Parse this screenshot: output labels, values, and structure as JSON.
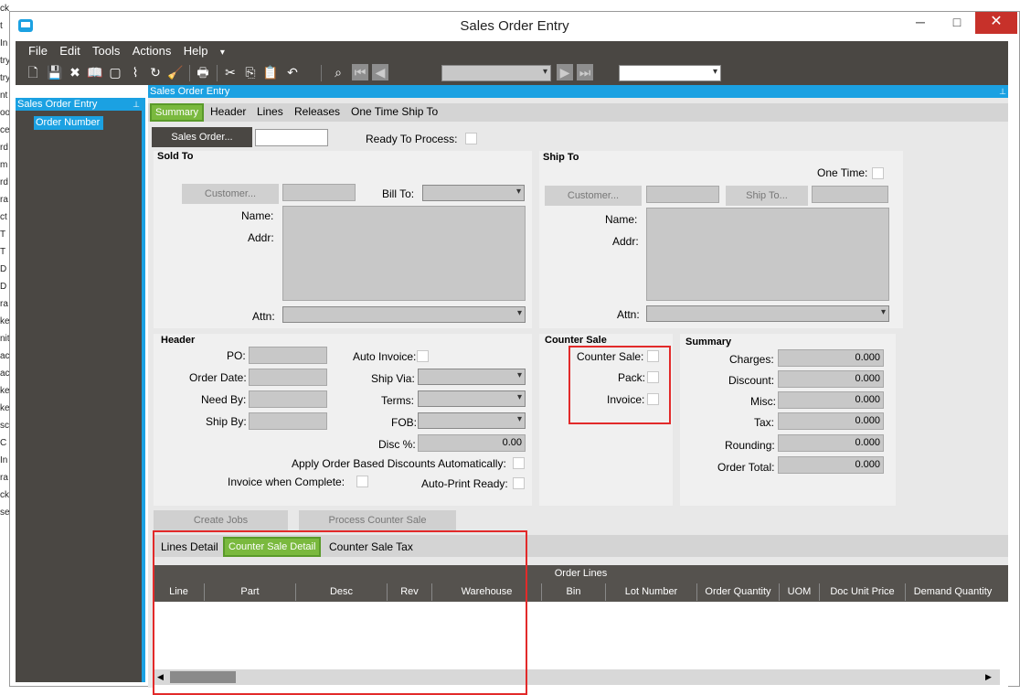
{
  "window": {
    "title": "Sales Order Entry"
  },
  "window_controls": {
    "minimize": "─",
    "maximize": "□",
    "close": "✕"
  },
  "menu": [
    "File",
    "Edit",
    "Tools",
    "Actions",
    "Help"
  ],
  "menu_more": "▾",
  "left_strip_text": [
    "ck",
    "t",
    "In",
    "try",
    "try",
    "nt",
    "oo",
    "ce",
    "rd",
    "m",
    "rd",
    "ra",
    "ct",
    "T",
    "T",
    "D",
    "D",
    "ra",
    "ke",
    "nit",
    "ac",
    "ac",
    "ke",
    "ke",
    "sc",
    "C",
    "In",
    "ra",
    "ck",
    "se"
  ],
  "tree": {
    "header": "Sales Order Entry",
    "pin": "📌",
    "selected": "Order Number"
  },
  "main_header": {
    "title": "Sales Order Entry",
    "pin": "📌"
  },
  "tabs": [
    "Summary",
    "Header",
    "Lines",
    "Releases",
    "One Time Ship To"
  ],
  "top": {
    "sales_order_btn": "Sales Order...",
    "ready_to_process": "Ready To Process:"
  },
  "sold_to": {
    "title": "Sold To",
    "customer_btn": "Customer...",
    "bill_to": "Bill To:",
    "name": "Name:",
    "addr": "Addr:",
    "attn": "Attn:"
  },
  "ship_to": {
    "title": "Ship To",
    "one_time": "One Time:",
    "customer_btn": "Customer...",
    "ship_to_btn": "Ship To...",
    "name": "Name:",
    "addr": "Addr:",
    "attn": "Attn:"
  },
  "header": {
    "title": "Header",
    "po": "PO:",
    "order_date": "Order Date:",
    "need_by": "Need By:",
    "ship_by": "Ship By:",
    "auto_invoice": "Auto Invoice:",
    "ship_via": "Ship Via:",
    "terms": "Terms:",
    "fob": "FOB:",
    "disc": "Disc %:",
    "disc_value": "0.00",
    "apply_discounts": "Apply Order Based Discounts Automatically:",
    "invoice_complete": "Invoice when Complete:",
    "auto_print": "Auto-Print Ready:"
  },
  "counter_sale": {
    "title": "Counter Sale",
    "counter_sale": "Counter Sale:",
    "pack": "Pack:",
    "invoice": "Invoice:"
  },
  "summary": {
    "title": "Summary",
    "rows": [
      {
        "label": "Charges:",
        "value": "0.000"
      },
      {
        "label": "Discount:",
        "value": "0.000"
      },
      {
        "label": "Misc:",
        "value": "0.000"
      },
      {
        "label": "Tax:",
        "value": "0.000"
      },
      {
        "label": "Rounding:",
        "value": "0.000"
      },
      {
        "label": "Order Total:",
        "value": "0.000"
      }
    ]
  },
  "actions": {
    "create_jobs": "Create Jobs",
    "process_counter_sale": "Process Counter Sale"
  },
  "lower_tabs": [
    "Lines Detail",
    "Counter Sale Detail",
    "Counter Sale Tax"
  ],
  "grid": {
    "title": "Order Lines",
    "columns": [
      "Line",
      "Part",
      "Desc",
      "Rev",
      "Warehouse",
      "Bin",
      "Lot Number",
      "Order Quantity",
      "UOM",
      "Doc Unit Price",
      "Demand Quantity"
    ]
  },
  "colors": {
    "accent": "#1ba1e2",
    "dark": "#4a4743",
    "tab_active": "#7ab93e",
    "highlight": "#e22a2a"
  }
}
